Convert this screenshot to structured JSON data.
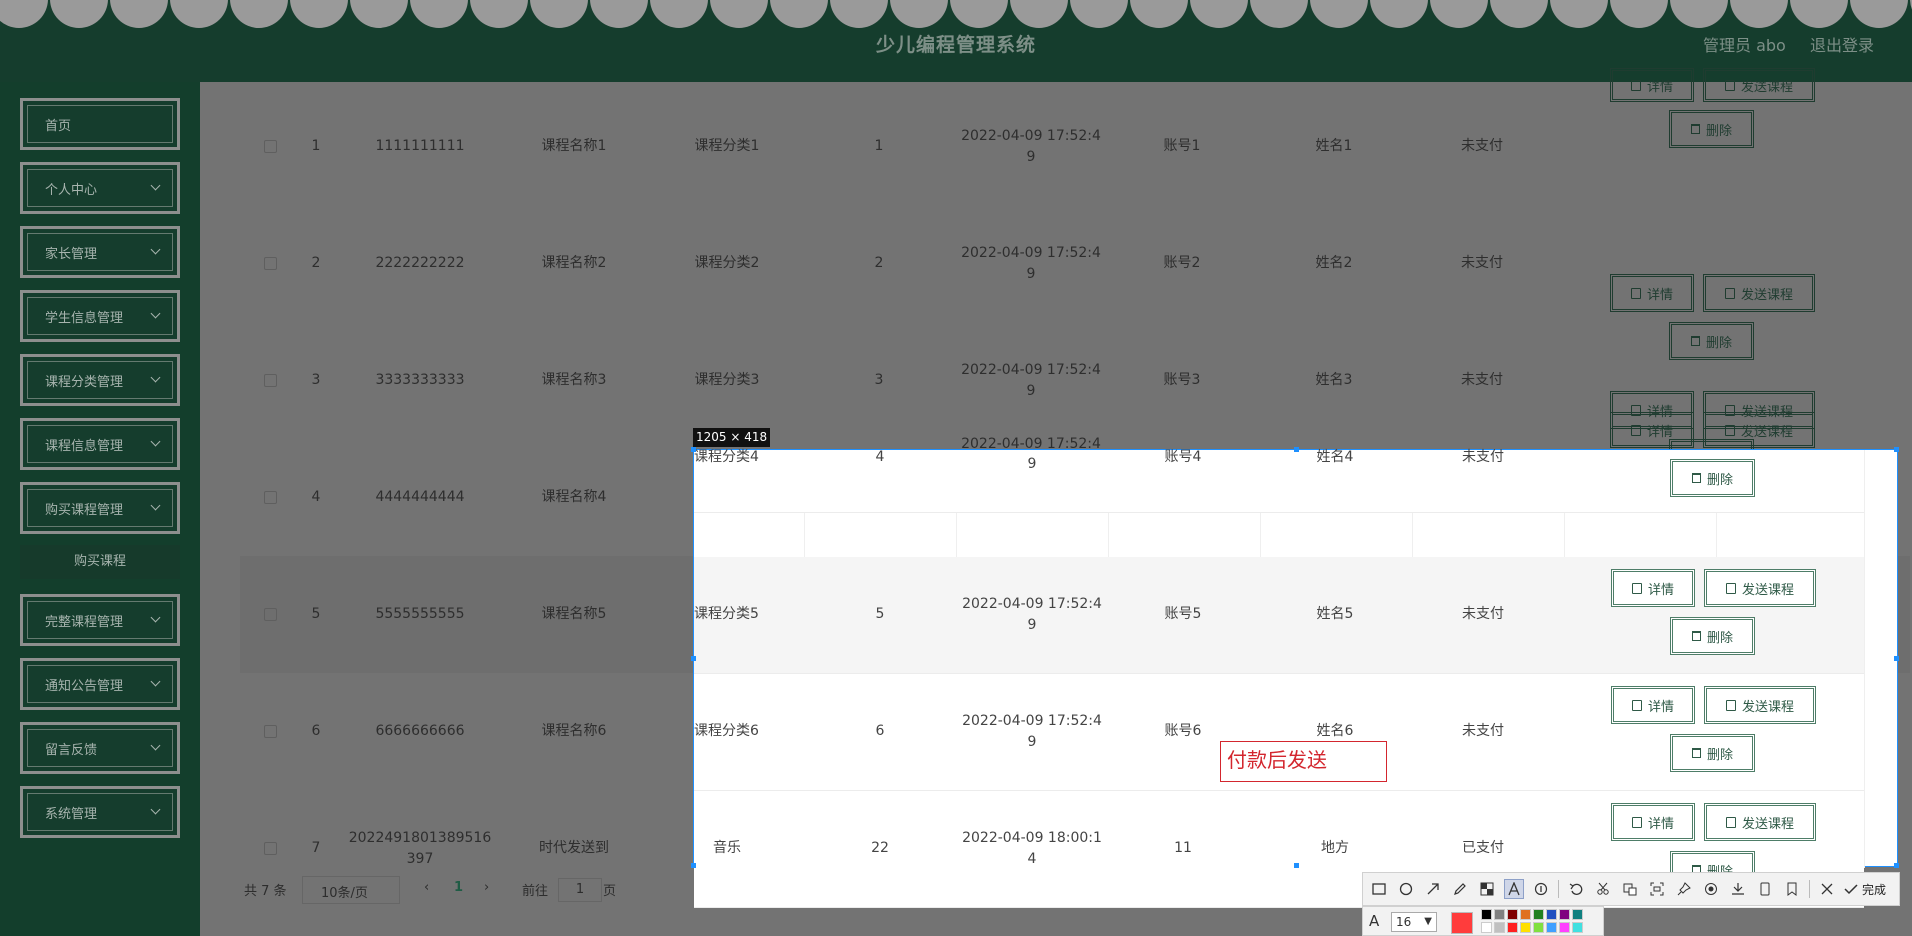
{
  "header": {
    "title": "少儿编程管理系统",
    "admin_label": "管理员 abo",
    "logout_label": "退出登录"
  },
  "sidebar": {
    "items": [
      {
        "label": "首页"
      },
      {
        "label": "个人中心"
      },
      {
        "label": "家长管理"
      },
      {
        "label": "学生信息管理"
      },
      {
        "label": "课程分类管理"
      },
      {
        "label": "课程信息管理"
      },
      {
        "label": "购买课程管理"
      },
      {
        "label": "完整课程管理"
      },
      {
        "label": "通知公告管理"
      },
      {
        "label": "留言反馈"
      },
      {
        "label": "系统管理"
      }
    ],
    "submenu_label": "购买课程"
  },
  "table": {
    "rows": [
      {
        "index": "1",
        "order_no": "1111111111",
        "course_name": "课程名称1",
        "category": "课程分类1",
        "price": "1",
        "time_line1": "2022-04-09 17:52:4",
        "time_line2": "9",
        "account": "账号1",
        "name": "姓名1",
        "status": "未支付"
      },
      {
        "index": "2",
        "order_no": "2222222222",
        "course_name": "课程名称2",
        "category": "课程分类2",
        "price": "2",
        "time_line1": "2022-04-09 17:52:4",
        "time_line2": "9",
        "account": "账号2",
        "name": "姓名2",
        "status": "未支付"
      },
      {
        "index": "3",
        "order_no": "3333333333",
        "course_name": "课程名称3",
        "category": "课程分类3",
        "price": "3",
        "time_line1": "2022-04-09 17:52:4",
        "time_line2": "9",
        "account": "账号3",
        "name": "姓名3",
        "status": "未支付"
      },
      {
        "index": "4",
        "order_no": "4444444444",
        "course_name": "课程名称4",
        "category": "课程分类4",
        "price": "4",
        "time_line1": "2022-04-09 17:52:4",
        "time_line2": "9",
        "account": "账号4",
        "name": "姓名4",
        "status": "未支付"
      },
      {
        "index": "5",
        "order_no": "5555555555",
        "course_name": "课程名称5",
        "category": "课程分类5",
        "price": "5",
        "time_line1": "2022-04-09 17:52:4",
        "time_line2": "9",
        "account": "账号5",
        "name": "姓名5",
        "status": "未支付"
      },
      {
        "index": "6",
        "order_no": "6666666666",
        "course_name": "课程名称6",
        "category": "课程分类6",
        "price": "6",
        "time_line1": "2022-04-09 17:52:4",
        "time_line2": "9",
        "account": "账号6",
        "name": "姓名6",
        "status": "未支付"
      },
      {
        "index": "7",
        "order_no_line1": "2022491801389516",
        "order_no_line2": "397",
        "course_name": "时代发送到",
        "category": "音乐",
        "price": "22",
        "time_line1": "2022-04-09 18:00:1",
        "time_line2": "4",
        "account": "11",
        "name": "地方",
        "status": "已支付"
      }
    ],
    "btn_detail": "详情",
    "btn_send": "发送课程",
    "btn_delete": "删除"
  },
  "pagination": {
    "total": "共 7 条",
    "page_size": "10条/页",
    "current_page": "1",
    "goto_label": "前往",
    "goto_value": "1",
    "page_suffix": "页"
  },
  "capture": {
    "size_label": "1205 × 418",
    "annotation_text": "付款后发送",
    "font_size": "16",
    "done_label": "完成",
    "current_color": "#ff3c3c",
    "palette_top": [
      "#000000",
      "#808080",
      "#800000",
      "#e07020",
      "#208020",
      "#2050c0",
      "#800080",
      "#108080"
    ],
    "palette_bottom": [
      "#ffffff",
      "#c0c0c0",
      "#ff2020",
      "#ffe000",
      "#80e040",
      "#40a0ff",
      "#ff40ff",
      "#40e0e0"
    ]
  },
  "colors": {
    "header_bg": "#153d2d",
    "sidebar_bg": "#133e2c",
    "accent": "#3e6a57",
    "overlay": "#737373",
    "selection_border": "#1e90ff",
    "annotation_red": "#d3262e"
  }
}
